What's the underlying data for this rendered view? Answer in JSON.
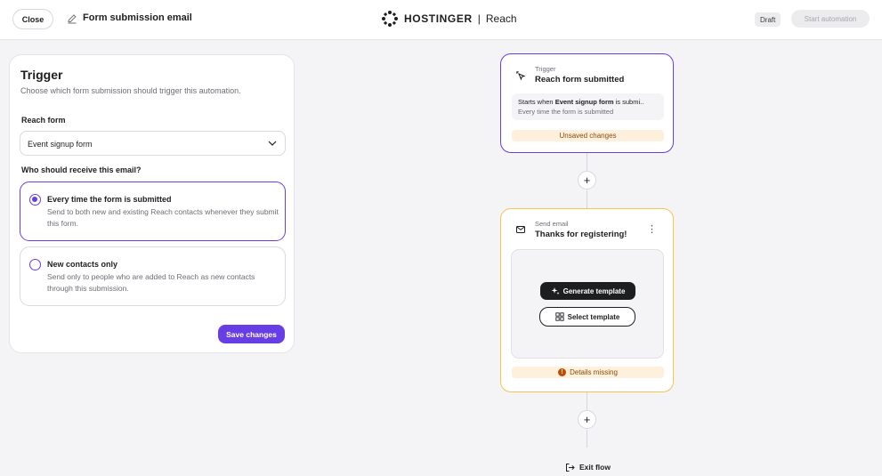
{
  "header": {
    "close_label": "Close",
    "title": "Form submission email",
    "brand_name": "HOSTINGER",
    "brand_separator": "|",
    "brand_product": "Reach",
    "status_badge": "Draft",
    "start_label": "Start automation"
  },
  "trigger_panel": {
    "title": "Trigger",
    "description": "Choose which form submission should trigger this automation.",
    "form_label": "Reach form",
    "form_value": "Event signup form",
    "recipients_label": "Who should receive this email?",
    "options": [
      {
        "title": "Every time the form is submitted",
        "description": "Send to both new and existing Reach contacts whenever they submit this form.",
        "selected": true
      },
      {
        "title": "New contacts only",
        "description": "Send only to people who are added to Reach as new contacts through this submission.",
        "selected": false
      }
    ],
    "save_label": "Save changes"
  },
  "flow": {
    "trigger_node": {
      "label": "Trigger",
      "title": "Reach form submitted",
      "summary_prefix": "Starts when ",
      "summary_form": "Event signup form",
      "summary_suffix": " is submi..",
      "summary_detail": "Every time the form is submitted",
      "warning": "Unsaved changes"
    },
    "add_step_symbol": "+",
    "email_node": {
      "label": "Send email",
      "title": "Thanks for registering!",
      "generate_label": "Generate template",
      "select_label": "Select template",
      "warning": "Details missing",
      "warning_symbol": "!"
    },
    "exit_label": "Exit flow"
  },
  "colors": {
    "accent": "#673de6",
    "email_border": "#f5c451",
    "warning_bg": "#fdf0dc",
    "warning_text": "#8a4b08"
  },
  "icons": {
    "edit": "pencil-icon",
    "logo": "hostinger-logo-icon",
    "trigger": "form-click-icon",
    "email": "mail-icon",
    "generate": "sparkle-icon",
    "select": "template-grid-icon",
    "exit": "exit-icon"
  }
}
